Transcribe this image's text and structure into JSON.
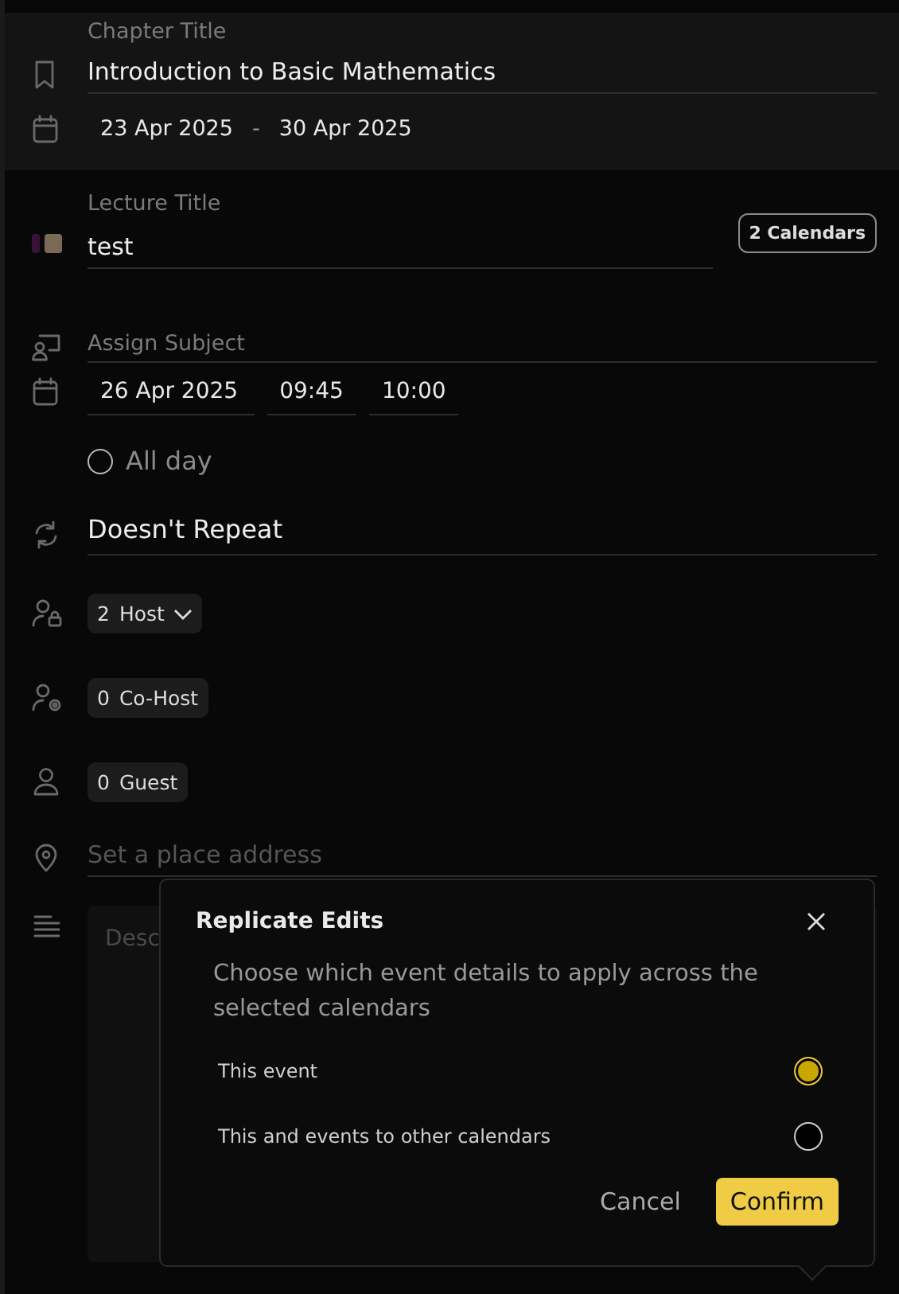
{
  "chapter": {
    "label": "Chapter Title",
    "value": "Introduction to Basic Mathematics",
    "start_date": "23 Apr 2025",
    "separator": "-",
    "end_date": "30 Apr 2025"
  },
  "lecture": {
    "label": "Lecture Title",
    "value": "test",
    "calendars_button": "2 Calendars",
    "swatches": [
      {
        "color": "#3a1238"
      },
      {
        "color": "#7a6a55"
      }
    ]
  },
  "subject": {
    "placeholder": "Assign Subject"
  },
  "schedule": {
    "date": "26 Apr 2025",
    "start_time": "09:45",
    "end_time": "10:00"
  },
  "all_day": {
    "label": "All day",
    "checked": false
  },
  "repeat": {
    "value": "Doesn't Repeat"
  },
  "people": [
    {
      "kind": "host",
      "count": "2",
      "label": "Host",
      "dropdown": true
    },
    {
      "kind": "cohost",
      "count": "0",
      "label": "Co-Host",
      "dropdown": false
    },
    {
      "kind": "guest",
      "count": "0",
      "label": "Guest",
      "dropdown": false
    }
  ],
  "place": {
    "placeholder": "Set a place address"
  },
  "description": {
    "placeholder": "Desc"
  },
  "dialog": {
    "title": "Replicate Edits",
    "message": "Choose which event details to apply across the selected calendars",
    "options": [
      {
        "label": "This event",
        "selected": true
      },
      {
        "label": "This and events to other calendars",
        "selected": false
      }
    ],
    "buttons": [
      {
        "label": "Cancel",
        "kind": "text"
      },
      {
        "label": "Confirm",
        "kind": "primary"
      }
    ]
  }
}
